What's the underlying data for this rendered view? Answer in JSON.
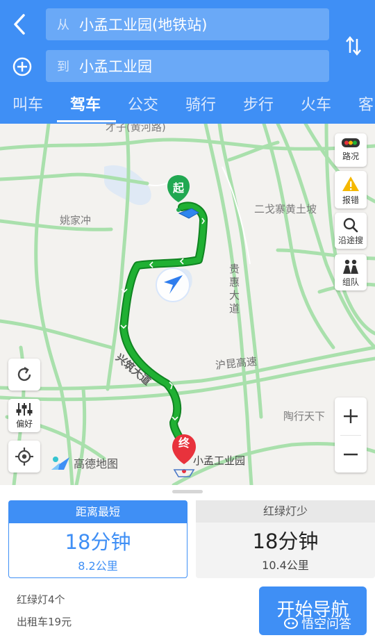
{
  "header": {
    "from_prefix": "从",
    "from_value": "小孟工业园(地铁站)",
    "to_prefix": "到",
    "to_value": "小孟工业园",
    "tabs": [
      "叫车",
      "驾车",
      "公交",
      "骑行",
      "步行",
      "火车",
      "客"
    ],
    "active_tab": "驾车"
  },
  "map": {
    "place_labels": [
      "才子(黄河路)",
      "姚家冲",
      "二戈寨黄土坡",
      "陶行天下"
    ],
    "road_labels": [
      "贵惠大道",
      "沪昆高速",
      "兴筑大道"
    ],
    "start_marker": "起",
    "end_marker": "终",
    "destination_label": "小孟工业园",
    "logo_text": "高德地图",
    "buttons": {
      "traffic": "路况",
      "report": "报错",
      "search_along": "沿途搜",
      "group": "组队",
      "preference": "偏好"
    }
  },
  "routes": [
    {
      "tag": "距离最短",
      "time": "18分钟",
      "distance": "8.2公里",
      "selected": true
    },
    {
      "tag": "红绿灯少",
      "time": "18分钟",
      "distance": "10.4公里",
      "selected": false
    }
  ],
  "summary": {
    "lights": "红绿灯4个",
    "taxi": "出租车19元"
  },
  "start_button": "开始导航",
  "watermark": "悟空问答",
  "colors": {
    "primary": "#3f8ff5",
    "route": "#20b033",
    "road": "#a9e0ac",
    "start_marker": "#21a851",
    "end_marker": "#e8323c"
  }
}
